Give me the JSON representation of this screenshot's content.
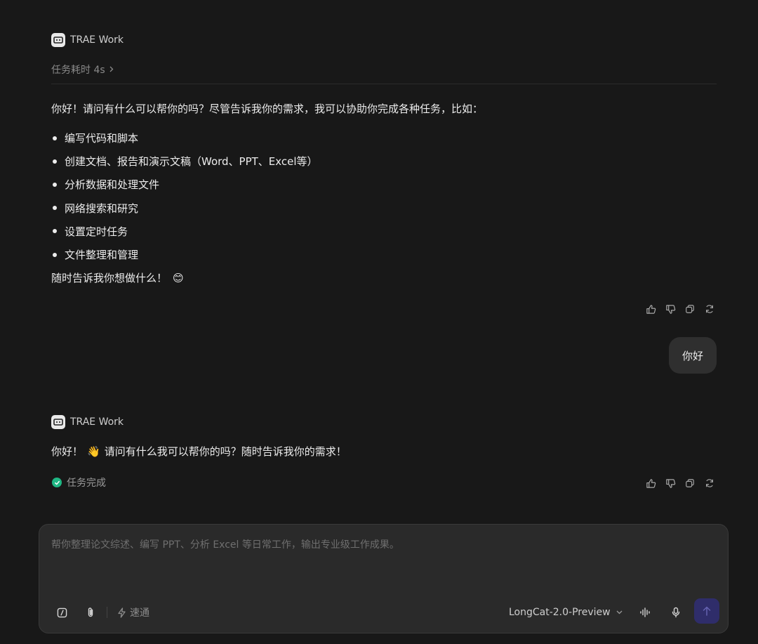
{
  "app_name": "TRAE Work",
  "messages": {
    "first": {
      "sender": "TRAE Work",
      "duration": "任务耗时 4s",
      "intro": "你好！请问有什么可以帮你的吗？尽管告诉我你的需求，我可以协助你完成各种任务，比如：",
      "items": [
        "编写代码和脚本",
        "创建文档、报告和演示文稿（Word、PPT、Excel等）",
        "分析数据和处理文件",
        "网络搜索和研究",
        "设置定时任务",
        "文件整理和管理"
      ],
      "closing_text": "随时告诉我你想做什么！",
      "closing_emoji": "😊"
    },
    "user": {
      "text": "你好"
    },
    "second": {
      "sender": "TRAE Work",
      "text_before": "你好！",
      "emoji": "👋",
      "text_after": "请问有什么我可以帮你的吗？随时告诉我你的需求！",
      "status": "任务完成"
    }
  },
  "composer": {
    "placeholder": "帮你整理论文综述、编写 PPT、分析 Excel 等日常工作，输出专业级工作成果。",
    "mode_label": "速通",
    "model": "LongCat-2.0-Preview"
  },
  "colors": {
    "background": "#181818",
    "status_green": "#1fb784",
    "send_button": "#2f2d6a",
    "bubble": "#2f2f2f"
  }
}
